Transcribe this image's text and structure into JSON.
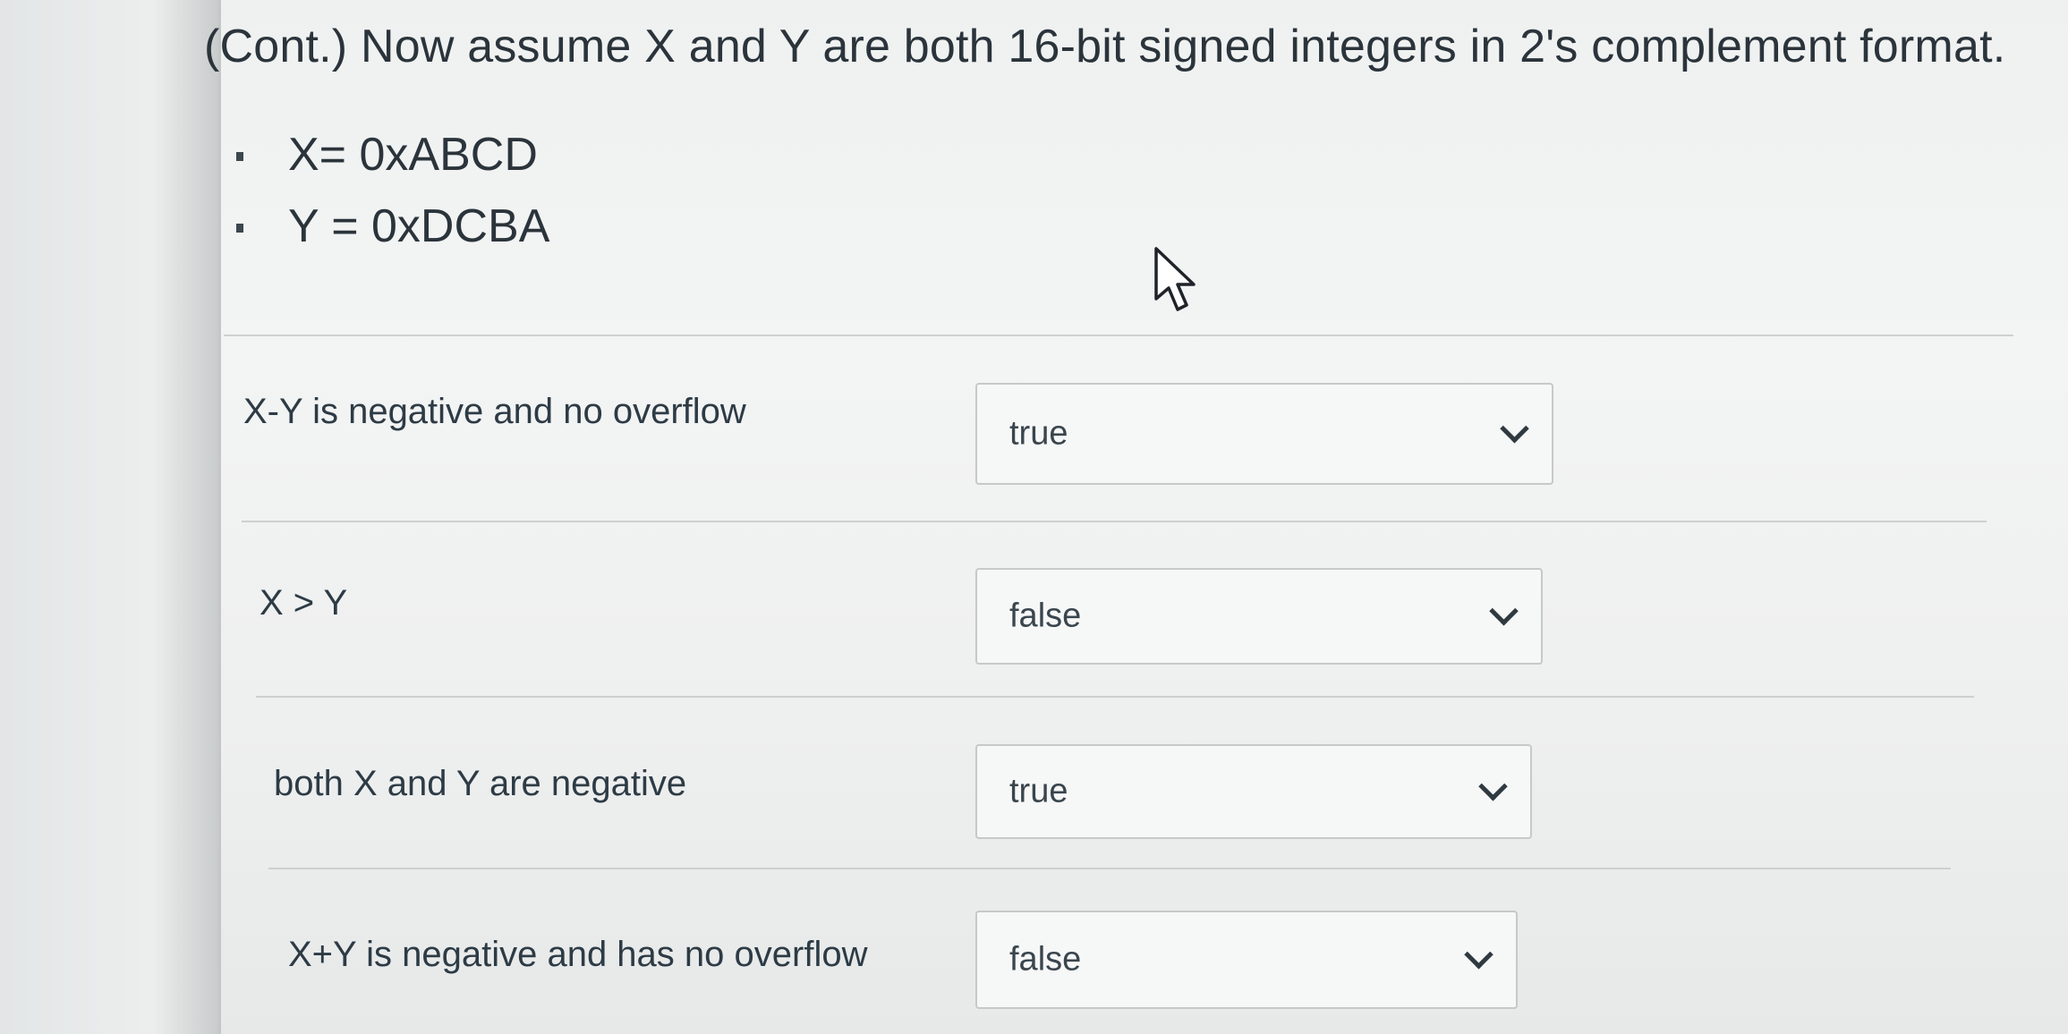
{
  "question": {
    "title": "(Cont.) Now assume X and Y are both 16-bit signed integers in 2's complement format.",
    "givens": [
      {
        "text": "X= 0xABCD"
      },
      {
        "text": "Y = 0xDCBA"
      }
    ]
  },
  "rows": [
    {
      "label": "X-Y is negative and no overflow",
      "selected": "true"
    },
    {
      "label": "X > Y",
      "selected": "false"
    },
    {
      "label": "both X and Y are negative",
      "selected": "true"
    },
    {
      "label": "X+Y is negative and has no overflow",
      "selected": "false"
    }
  ],
  "icons": {
    "dropdown": "chevron-down-icon",
    "bullet": "bullet-icon",
    "pointer": "mouse-cursor-icon"
  }
}
